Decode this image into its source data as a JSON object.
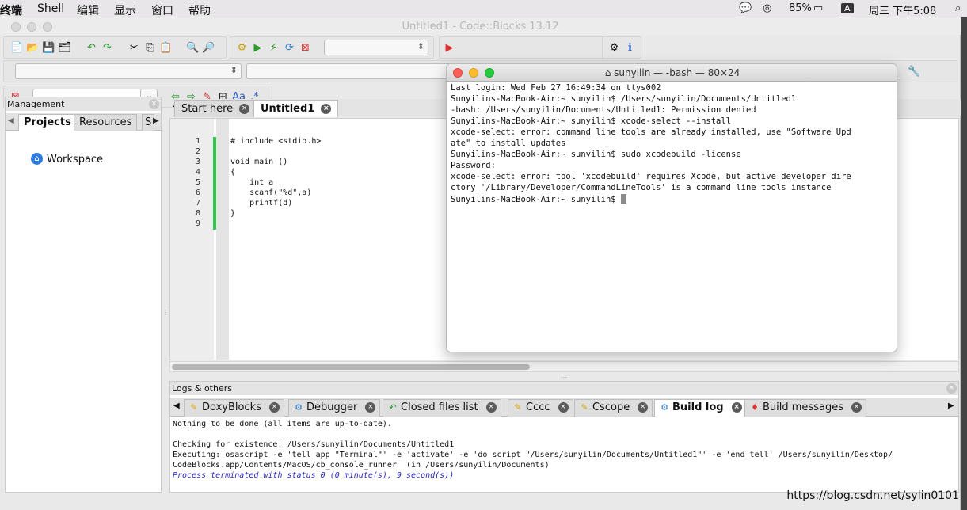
{
  "menubar": {
    "app": "终端",
    "items": [
      "Shell",
      "编辑",
      "显示",
      "窗口",
      "帮助"
    ],
    "battery": "85%",
    "input_method": "A",
    "clock": "周三 下午5:08"
  },
  "window": {
    "title": "Untitled1 - Code::Blocks 13.12"
  },
  "management": {
    "title": "Management",
    "tabs": [
      "Projects",
      "Resources",
      "S"
    ],
    "tree_root": "Workspace"
  },
  "editor": {
    "tabs": [
      "Start here",
      "Untitled1"
    ],
    "active_tab": "Untitled1",
    "line_numbers": [
      "1",
      "2",
      "3",
      "4",
      "5",
      "6",
      "7",
      "8",
      "9"
    ],
    "code_lines": [
      "# include <stdio.h>",
      "",
      "void main ()",
      "{",
      "    int a",
      "    scanf(\"%d\",a)",
      "    printf(d)",
      "}",
      ""
    ]
  },
  "terminal": {
    "title": "sunyilin — -bash — 80×24",
    "lines": [
      "Last login: Wed Feb 27 16:49:34 on ttys002",
      "Sunyilins-MacBook-Air:~ sunyilin$ /Users/sunyilin/Documents/Untitled1",
      "-bash: /Users/sunyilin/Documents/Untitled1: Permission denied",
      "Sunyilins-MacBook-Air:~ sunyilin$ xcode-select --install",
      "xcode-select: error: command line tools are already installed, use \"Software Upd",
      "ate\" to install updates",
      "Sunyilins-MacBook-Air:~ sunyilin$ sudo xcodebuild -license",
      "Password:",
      "xcode-select: error: tool 'xcodebuild' requires Xcode, but active developer dire",
      "ctory '/Library/Developer/CommandLineTools' is a command line tools instance",
      "Sunyilins-MacBook-Air:~ sunyilin$ "
    ]
  },
  "logs": {
    "title": "Logs & others",
    "tabs": [
      "DoxyBlocks",
      "Debugger",
      "Closed files list",
      "Cccc",
      "Cscope",
      "Build log",
      "Build messages"
    ],
    "active_tab": "Build log",
    "lines": [
      "Nothing to be done (all items are up-to-date).",
      "",
      "Checking for existence: /Users/sunyilin/Documents/Untitled1",
      "Executing: osascript -e 'tell app \"Terminal\"' -e 'activate' -e 'do script \"/Users/sunyilin/Documents/Untitled1\"' -e 'end tell' /Users/sunyilin/Desktop/",
      "CodeBlocks.app/Contents/MacOS/cb_console_runner  (in /Users/sunyilin/Documents)",
      "Process terminated with status 0 (0 minute(s), 9 second(s))"
    ]
  },
  "watermark": "https://blog.csdn.net/sylin0101"
}
